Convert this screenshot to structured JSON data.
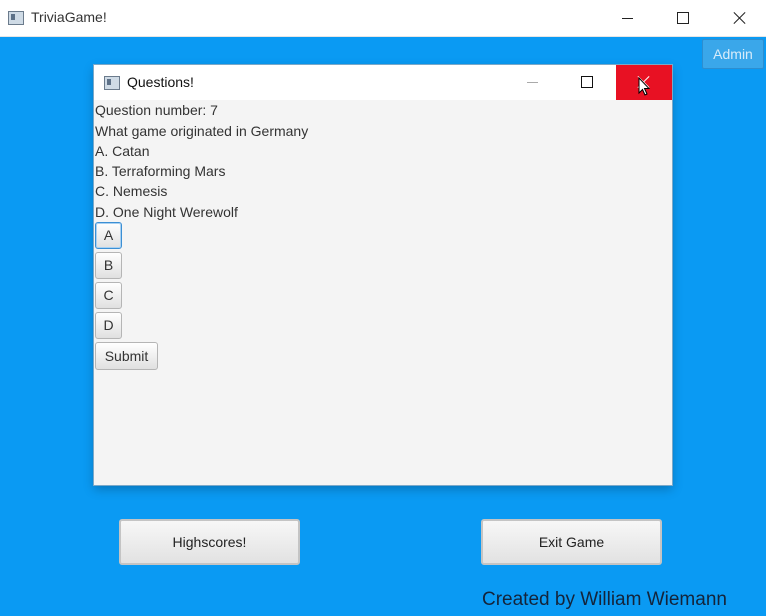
{
  "main_window": {
    "title": "TriviaGame!",
    "icon": "app-window-icon",
    "controls": [
      "minimize-icon",
      "maximize-icon",
      "close-icon"
    ]
  },
  "admin_button": {
    "label": "Admin"
  },
  "dialog": {
    "title": "Questions!",
    "icon": "app-window-icon",
    "controls": [
      "minimize-icon",
      "maximize-icon",
      "close-icon"
    ],
    "close_button_color": "#e81123",
    "question_number": "Question number: 7",
    "question": "What game originated in Germany",
    "options": [
      "A. Catan",
      "B. Terraforming Mars",
      "C. Nemesis",
      "D. One Night Werewolf"
    ],
    "answer_buttons": [
      "A",
      "B",
      "C",
      "D"
    ],
    "submit_label": "Submit"
  },
  "bottom_buttons": {
    "highscores_label": "Highscores!",
    "exit_label": "Exit Game"
  },
  "credit": "Created by William Wiemann",
  "colors": {
    "background": "#0a9af3",
    "dialog_background": "#f4f4f4"
  }
}
